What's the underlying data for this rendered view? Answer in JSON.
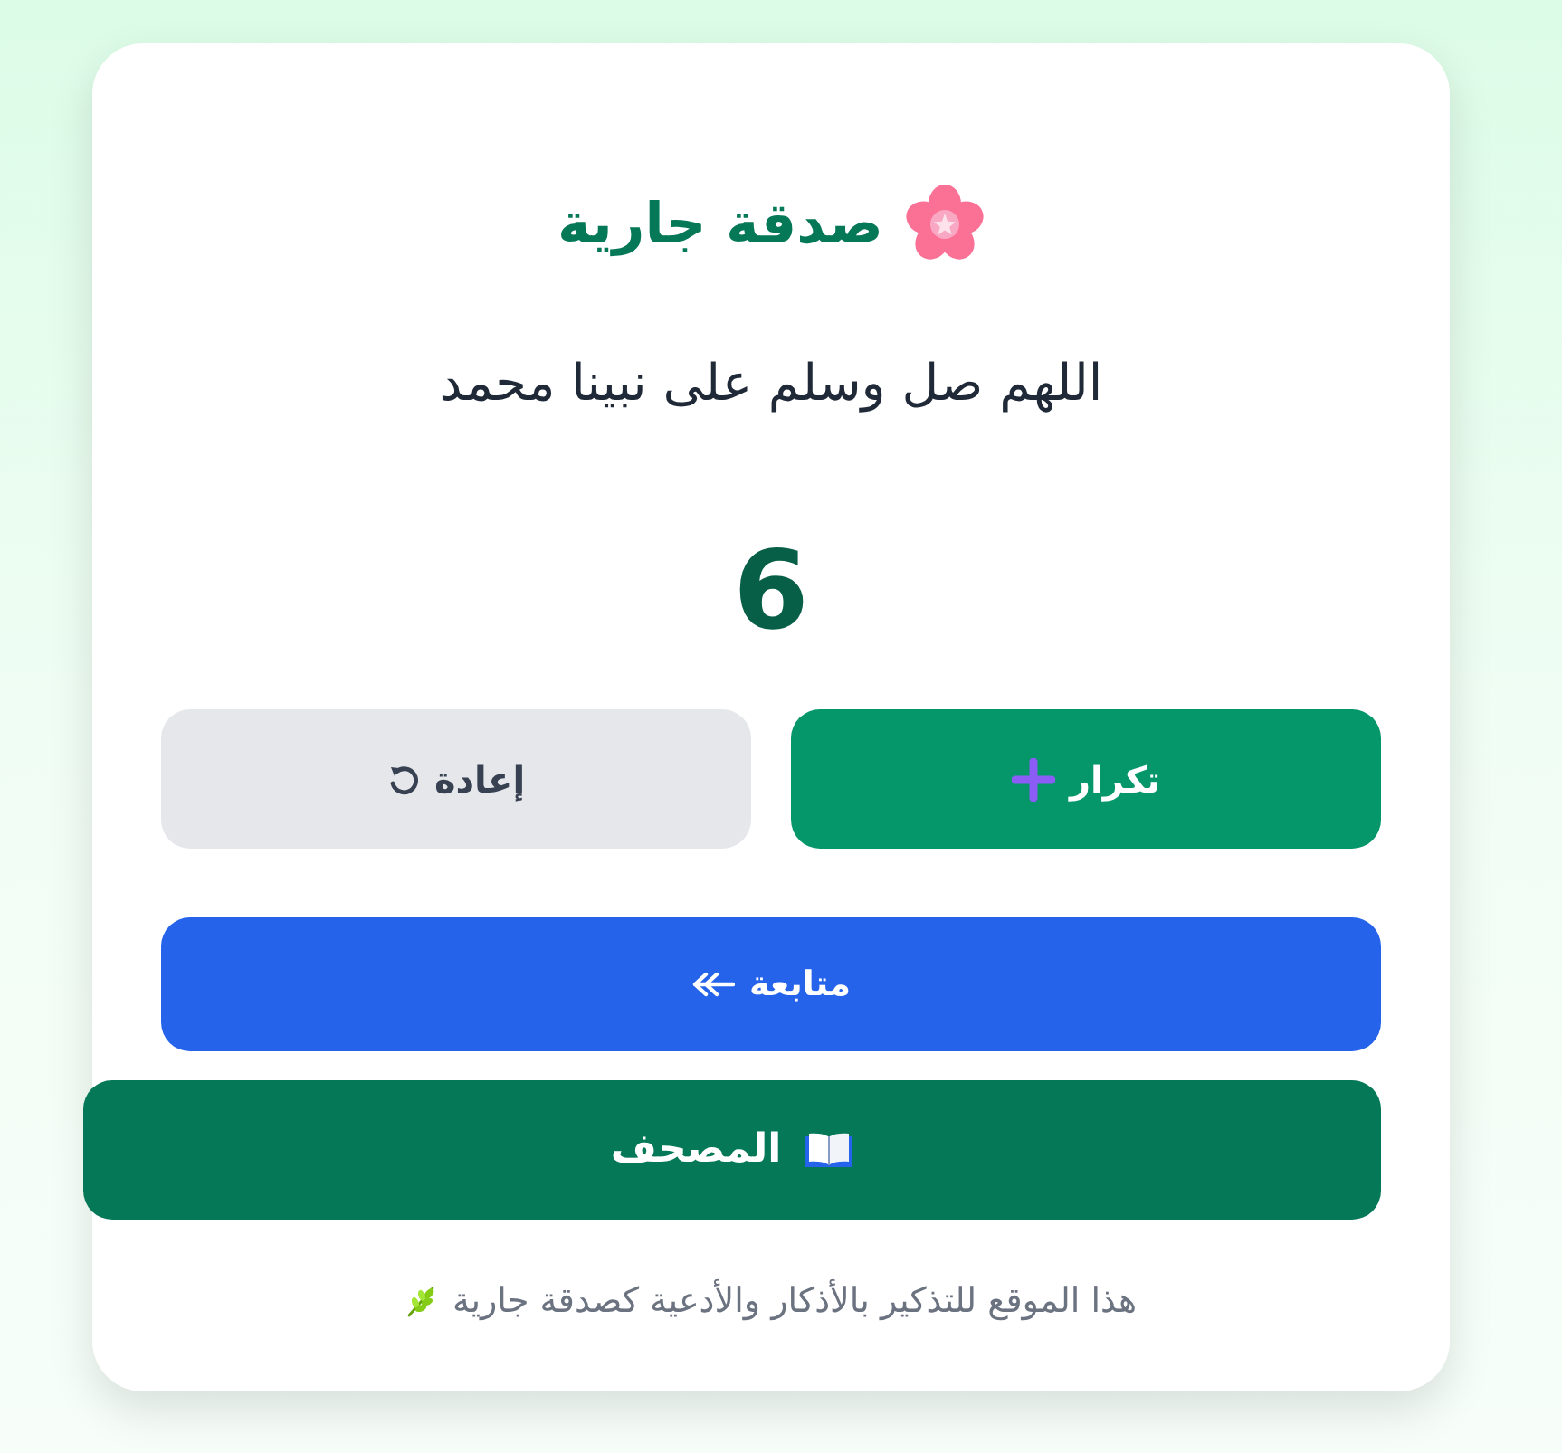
{
  "title": {
    "text": "صدقة جارية"
  },
  "dhikr": "اللهم صل وسلم على نبينا محمد",
  "counter": "6",
  "buttons": [
    {
      "kind": "repeat",
      "label": "تكرار"
    },
    {
      "kind": "reset",
      "label": "إعادة"
    }
  ],
  "continue_button": {
    "label": "متابعة"
  },
  "mushaf_button": {
    "label": "المصحف"
  },
  "footer": "هذا الموقع للتذكير بالأذكار والأدعية كصدقة جارية"
}
